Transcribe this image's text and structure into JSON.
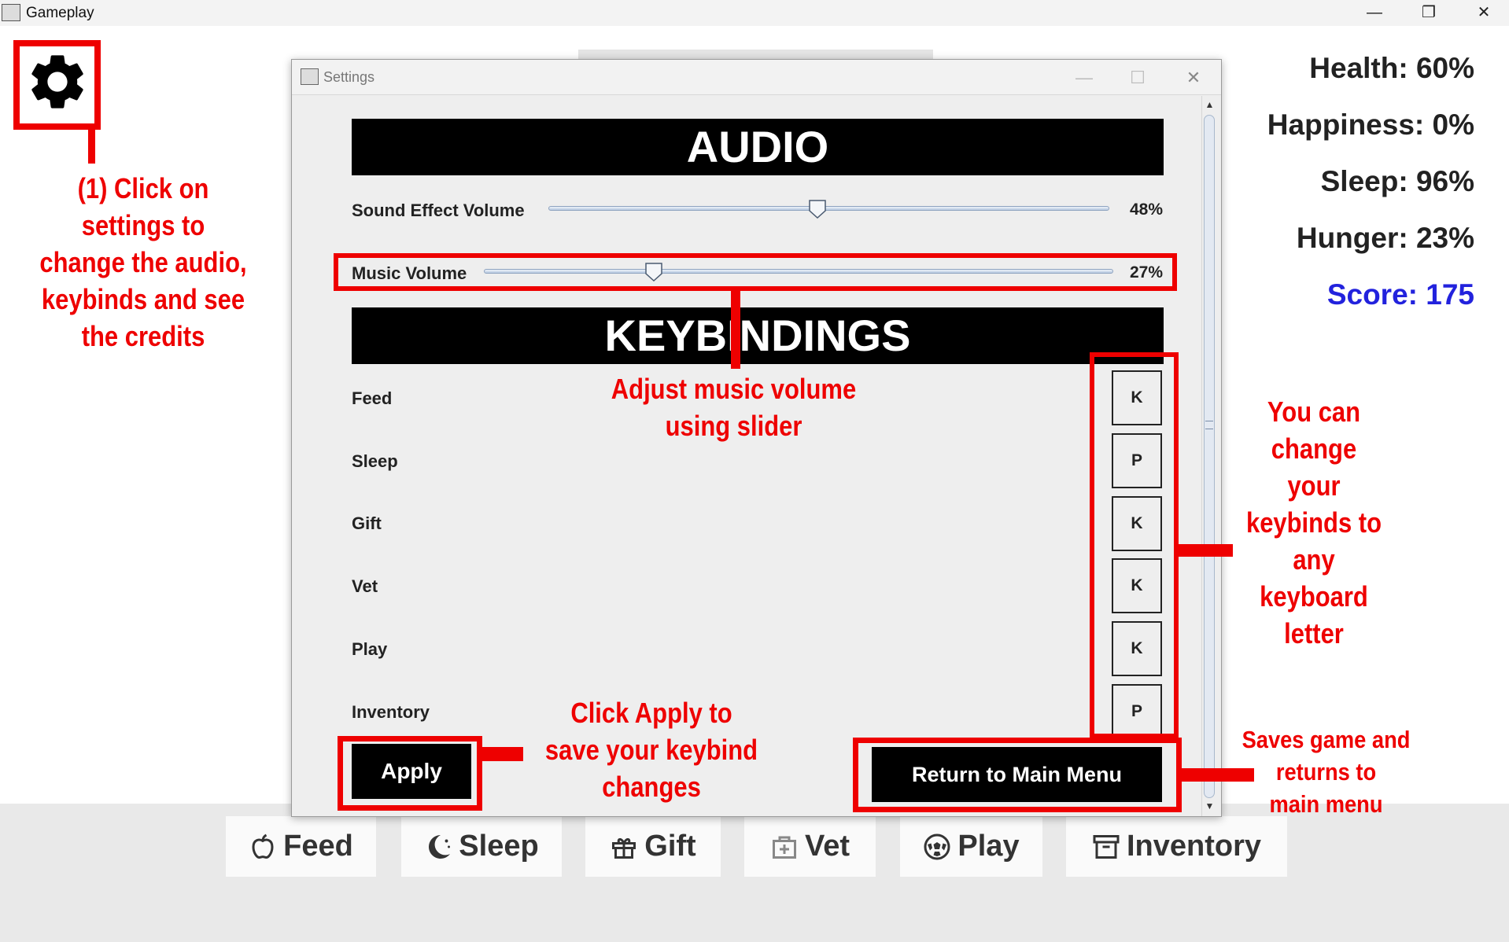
{
  "window": {
    "title": "Gameplay",
    "controls": {
      "minimize": "—",
      "restore": "❐",
      "close": "✕"
    }
  },
  "stats": {
    "health": "Health: 60%",
    "happiness": "Happiness: 0%",
    "sleep": "Sleep: 96%",
    "hunger": "Hunger: 23%",
    "score": "Score: 175"
  },
  "colors": {
    "score": "#2222dd",
    "annotation": "#ee0000",
    "section_bar": "#000000"
  },
  "bottom_bar": [
    {
      "label": "Feed",
      "icon": "apple-icon"
    },
    {
      "label": "Sleep",
      "icon": "moon-icon"
    },
    {
      "label": "Gift",
      "icon": "gift-icon"
    },
    {
      "label": "Vet",
      "icon": "medkit-icon"
    },
    {
      "label": "Play",
      "icon": "soccer-ball-icon"
    },
    {
      "label": "Inventory",
      "icon": "box-icon"
    }
  ],
  "settings": {
    "title": "Settings",
    "audio_heading": "AUDIO",
    "sound_effect": {
      "label": "Sound Effect Volume",
      "value": 48,
      "display": "48%"
    },
    "music": {
      "label": "Music Volume",
      "value": 27,
      "display": "27%"
    },
    "keybindings_heading": "KEYBINDINGS",
    "keybindings": [
      {
        "action": "Feed",
        "key": "K"
      },
      {
        "action": "Sleep",
        "key": "P"
      },
      {
        "action": "Gift",
        "key": "K"
      },
      {
        "action": "Vet",
        "key": "K"
      },
      {
        "action": "Play",
        "key": "K"
      },
      {
        "action": "Inventory",
        "key": "P"
      }
    ],
    "apply_label": "Apply",
    "return_label": "Return to Main Menu"
  },
  "annotations": {
    "settings": "(1) Click on\nsettings to\nchange the audio,\nkeybinds and see\nthe credits",
    "music": "Adjust music volume\nusing slider",
    "keybinds": "You can\nchange\nyour\nkeybinds to\nany\nkeyboard\nletter",
    "apply": "Click Apply to\nsave your keybind\nchanges",
    "return": "Saves game and\nreturns to\nmain menu"
  }
}
